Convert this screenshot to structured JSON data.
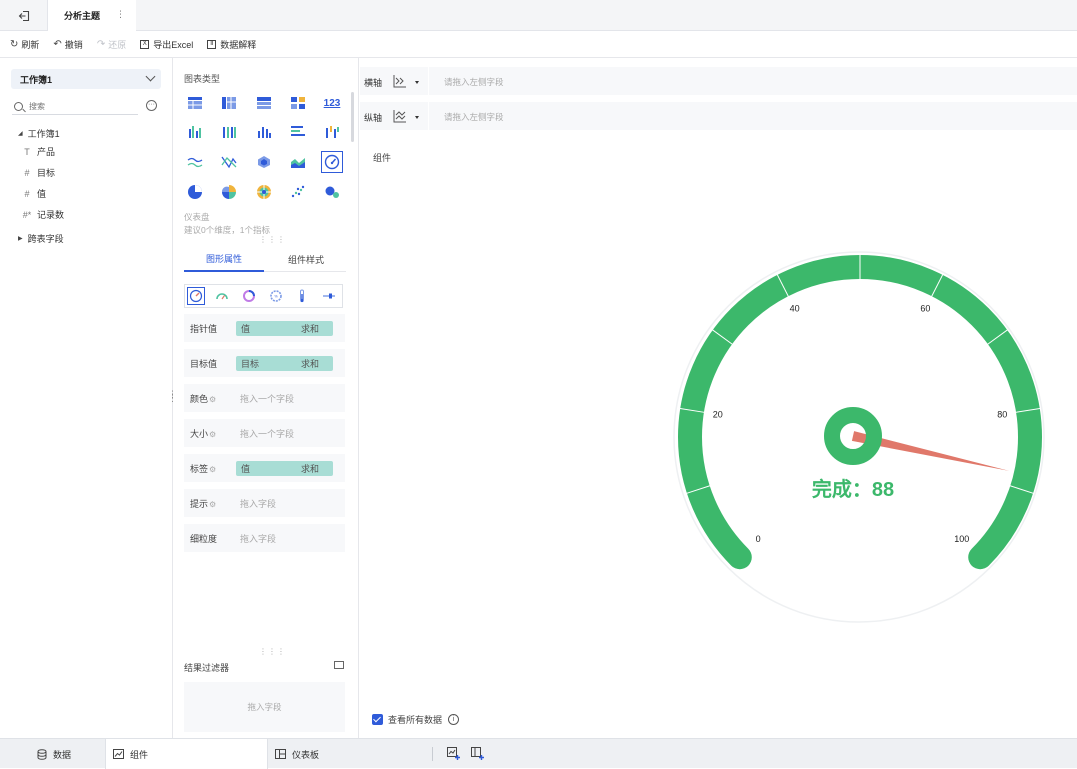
{
  "topbar": {
    "back_icon": "exit-icon",
    "tab_title": "分析主题",
    "tab_more": "⋮"
  },
  "toolbar": {
    "refresh": "刷新",
    "undo": "撤销",
    "redo": "还原",
    "export": "导出Excel",
    "explain": "数据解释"
  },
  "left": {
    "workbook": "工作簿1",
    "search_placeholder": "搜索",
    "tree_root": "工作簿1",
    "fields": [
      {
        "type": "T",
        "name": "产品"
      },
      {
        "type": "#",
        "name": "目标"
      },
      {
        "type": "#",
        "name": "值"
      },
      {
        "type": "#*",
        "name": "记录数"
      }
    ],
    "cross_table": "跨表字段"
  },
  "middle": {
    "chart_type_title": "图表类型",
    "chart_name": "仪表盘",
    "chart_hint": "建议0个维度，1个指标",
    "tab_shape": "图形属性",
    "tab_style": "组件样式",
    "props": [
      {
        "label": "指针值",
        "field": "值",
        "agg": "求和",
        "gear": false
      },
      {
        "label": "目标值",
        "field": "目标",
        "agg": "求和",
        "gear": false
      },
      {
        "label": "颜色",
        "placeholder": "拖入一个字段",
        "gear": true
      },
      {
        "label": "大小",
        "placeholder": "拖入一个字段",
        "gear": true
      },
      {
        "label": "标签",
        "field": "值",
        "agg": "求和",
        "gear": true
      },
      {
        "label": "提示",
        "placeholder": "拖入字段",
        "gear": true
      },
      {
        "label": "细粒度",
        "placeholder": "拖入字段",
        "gear": false
      }
    ],
    "filter_title": "结果过滤器",
    "filter_placeholder": "拖入字段"
  },
  "axes": {
    "x_label": "横轴",
    "x_placeholder": "请拖入左侧字段",
    "y_label": "纵轴",
    "y_placeholder": "请拖入左侧字段"
  },
  "canvas": {
    "label": "组件",
    "view_all": "查看所有数据",
    "info_glyph": "i"
  },
  "chart_data": {
    "type": "gauge",
    "min": 0,
    "max": 100,
    "ticks": [
      "0",
      "20",
      "40",
      "60",
      "80",
      "100"
    ],
    "tick_values": [
      0,
      20,
      40,
      60,
      80,
      100
    ],
    "value": 88,
    "value_label": "完成：88",
    "color_arc": "#3cb86b",
    "color_needle": "#e0786a"
  },
  "bottombar": {
    "data": "数据",
    "widget": "组件",
    "dashboard": "仪表板"
  }
}
